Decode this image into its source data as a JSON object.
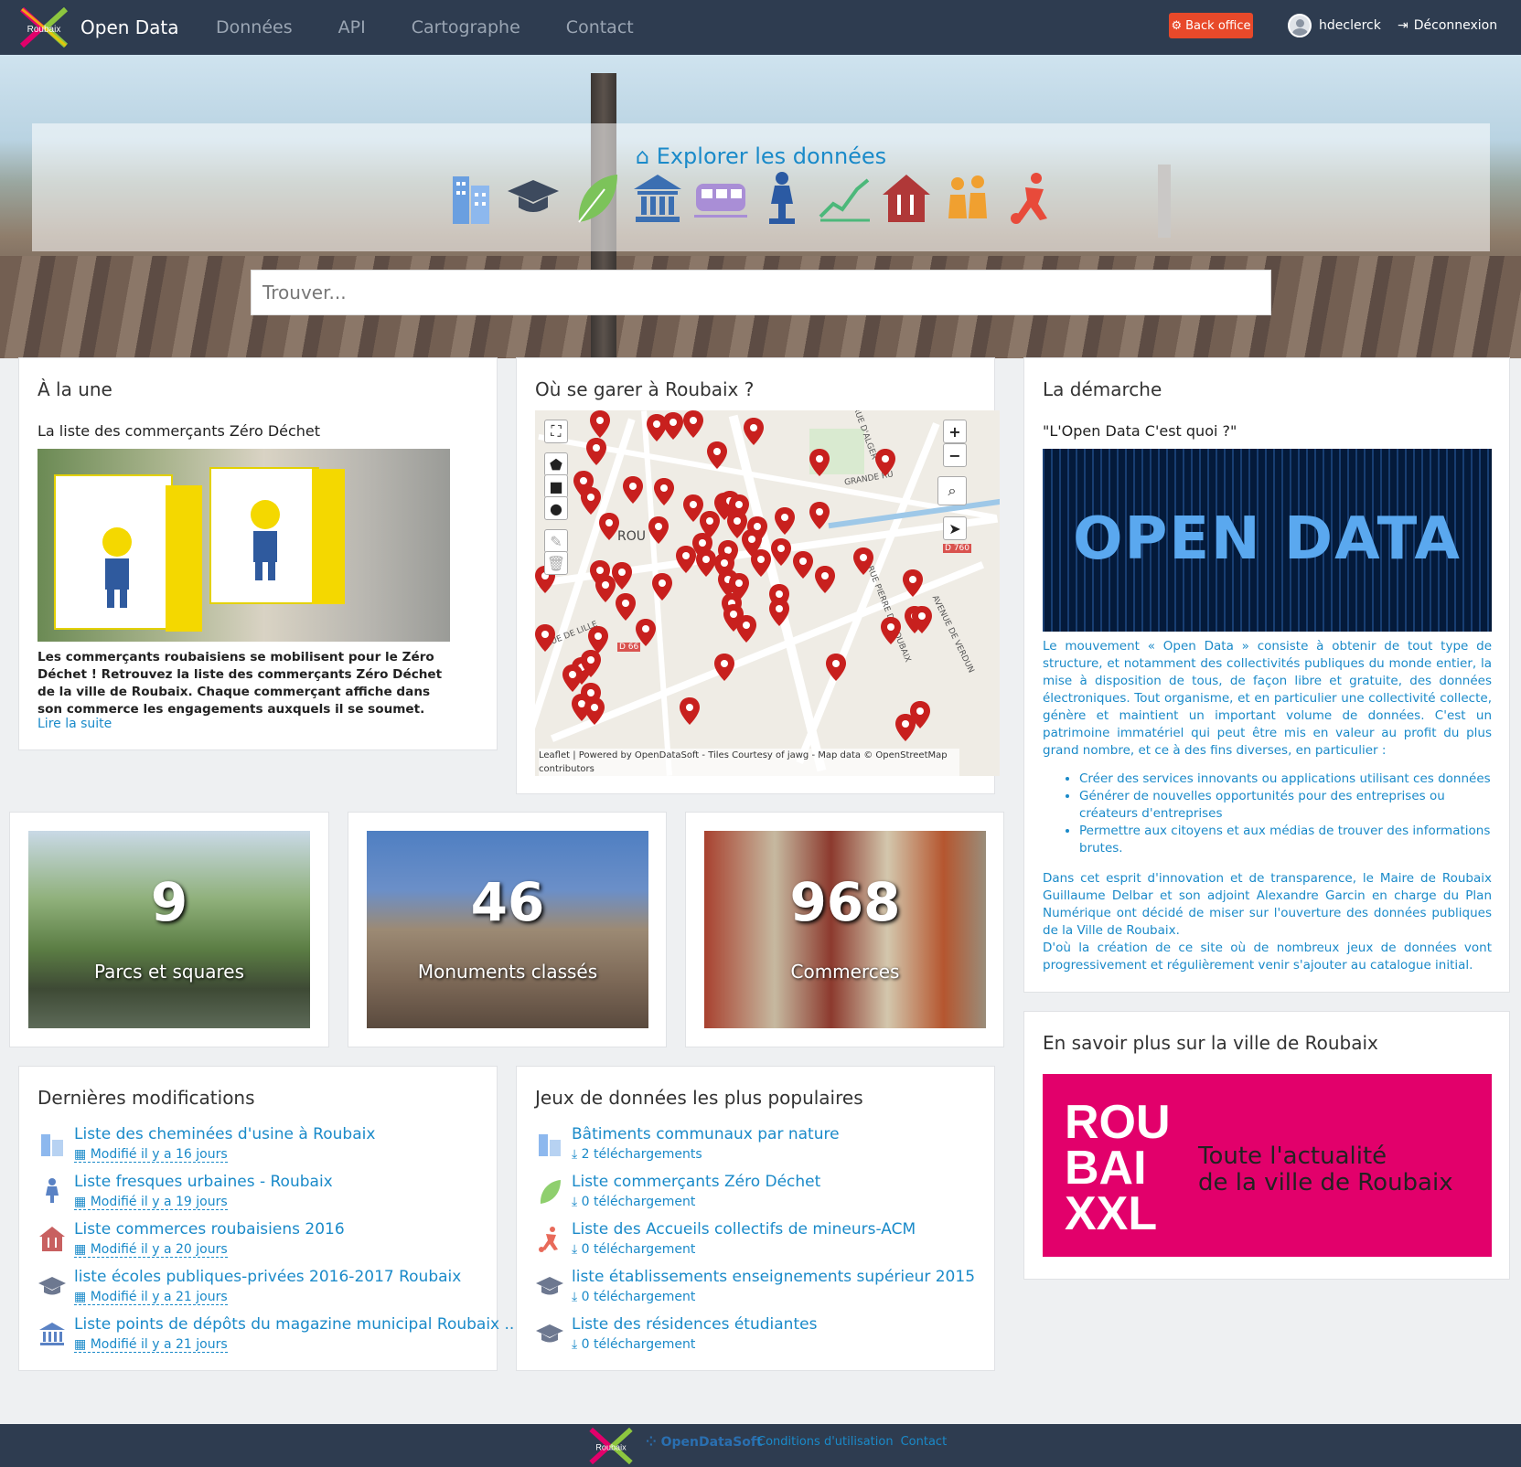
{
  "nav": {
    "brand": "Open Data",
    "logo_text": "Roubaix",
    "links": [
      "Données",
      "API",
      "Cartographe",
      "Contact"
    ],
    "backoffice": "Back office",
    "user": "hdeclerck",
    "logout": "Déconnexion"
  },
  "hero": {
    "explore_title": "Explorer les données",
    "themes": [
      "building-icon",
      "graduation-cap-icon",
      "leaf-icon",
      "institution-icon",
      "train-icon",
      "statue-icon",
      "chart-icon",
      "restaurant-icon",
      "people-icon",
      "sport-icon"
    ],
    "search_placeholder": "Trouver..."
  },
  "une": {
    "title": "À la une",
    "subtitle": "La liste des commerçants Zéro Déchet",
    "description": "Les commerçants roubaisiens se mobilisent pour le Zéro Déchet ! Retrouvez la liste des commerçants Zéro Déchet de la ville de Roubaix. Chaque commerçant affiche dans son commerce les engagements auxquels il se soumet.",
    "more": "Lire la suite"
  },
  "parking": {
    "title": "Où se garer à Roubaix ?",
    "attribution": "Leaflet | Powered by OpenDataSoft - Tiles Courtesy of jawg - Map data © OpenStreetMap contributors",
    "labels": [
      "RUE D'ALGER",
      "GRANDE RU",
      "D 760",
      "RUE DE LILLE",
      "D 66",
      "RUE PIERRE DE ROUBAIX",
      "AVENUE DE VERDUN",
      "ROU"
    ]
  },
  "stats": [
    {
      "value": "9",
      "label": "Parcs et squares"
    },
    {
      "value": "46",
      "label": "Monuments classés"
    },
    {
      "value": "968",
      "label": "Commerces"
    }
  ],
  "recent": {
    "title": "Dernières modifications",
    "items": [
      {
        "title": "Liste des cheminées d'usine à Roubaix",
        "meta": "Modifié il y a 16 jours"
      },
      {
        "title": "Liste fresques urbaines - Roubaix",
        "meta": "Modifié il y a 19 jours"
      },
      {
        "title": "Liste commerces roubaisiens 2016",
        "meta": "Modifié il y a 20 jours"
      },
      {
        "title": "liste écoles publiques-privées 2016-2017 Roubaix",
        "meta": "Modifié il y a 21 jours"
      },
      {
        "title": "Liste points de dépôts du magazine municipal Roubaix ...",
        "meta": "Modifié il y a 21 jours"
      }
    ]
  },
  "popular": {
    "title": "Jeux de données les plus populaires",
    "items": [
      {
        "title": "Bâtiments communaux par nature",
        "meta": "2 téléchargements"
      },
      {
        "title": "Liste commerçants Zéro Déchet",
        "meta": "0 téléchargement"
      },
      {
        "title": "Liste des Accueils collectifs de mineurs-ACM",
        "meta": "0 téléchargement"
      },
      {
        "title": "liste établissements enseignements supérieur 2015",
        "meta": "0 téléchargement"
      },
      {
        "title": "Liste des résidences étudiantes",
        "meta": "0 téléchargement"
      }
    ]
  },
  "demarche": {
    "title": "La démarche",
    "subtitle": "\"L'Open Data C'est quoi ?\"",
    "image_text": "OPEN DATA",
    "p1": "Le mouvement « Open Data » consiste à obtenir de tout type de structure, et notamment des collectivités publiques du monde entier, la mise à disposition de tous, de façon libre et gratuite, des données électroniques. Tout organisme, et en particulier une collectivité collecte, génère et maintient un important volume de données. C'est un patrimoine immatériel qui peut être mis en valeur au profit du plus grand nombre, et ce à des fins diverses, en particulier :",
    "bullets": [
      "Créer des services innovants ou applications utilisant ces données",
      "Générer de nouvelles opportunités pour des entreprises ou créateurs d'entreprises",
      "Permettre aux citoyens et aux médias de trouver des informations brutes."
    ],
    "p2": "Dans cet esprit d'innovation et de transparence, le Maire de Roubaix Guillaume Delbar et son adjoint Alexandre Garcin en charge du Plan Numérique ont décidé de miser sur l'ouverture des données publiques de la Ville de Roubaix.",
    "p3": "D'où la création de ce site où de nombreux jeux de données vont progressivement et régulièrement venir s'ajouter au catalogue initial."
  },
  "savoir": {
    "title": "En savoir plus sur la ville de Roubaix",
    "logo_lines": [
      "ROU",
      "BAI",
      "XXL"
    ],
    "tagline1": "Toute l'actualité",
    "tagline2": "de la ville de Roubaix"
  },
  "footer": {
    "logo_text": "Roubaix",
    "ods": "OpenDataSoft",
    "links": [
      "Conditions d'utilisation",
      "Contact"
    ]
  }
}
